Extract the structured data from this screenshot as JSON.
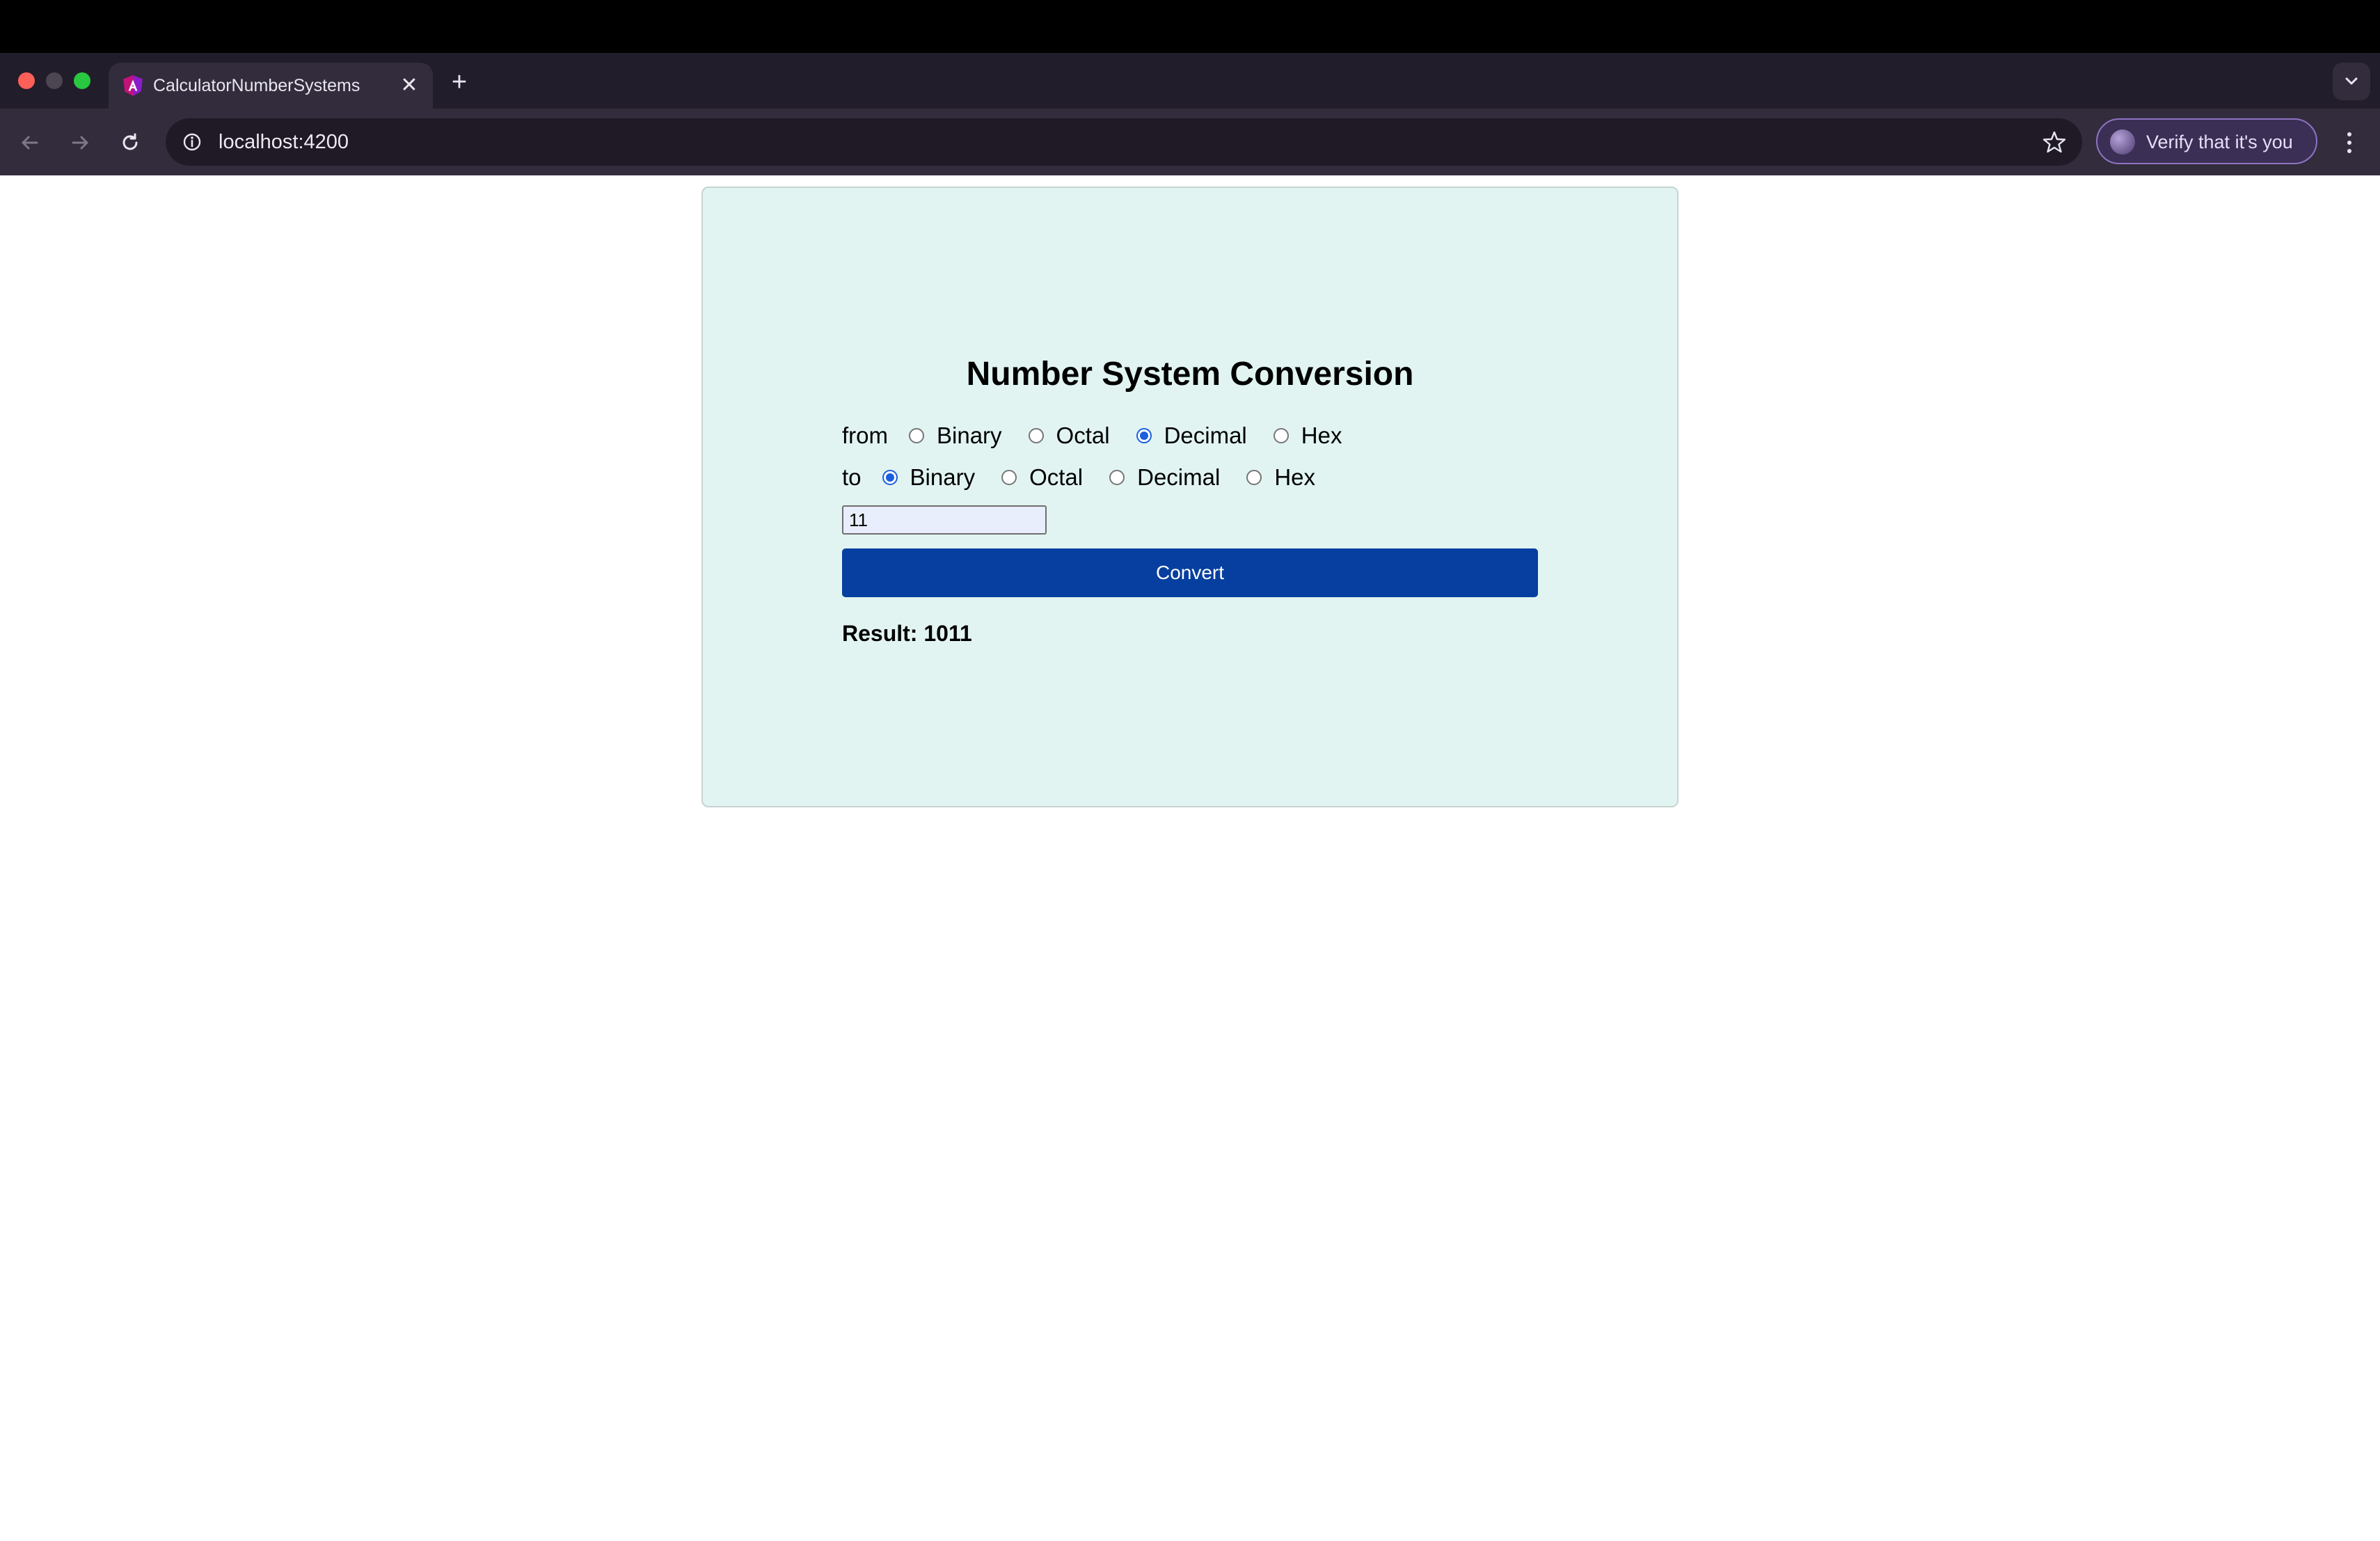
{
  "browser": {
    "tab": {
      "title": "CalculatorNumberSystems",
      "close_glyph": "✕"
    },
    "new_tab_glyph": "+",
    "address": {
      "url": "localhost:4200"
    },
    "profile": {
      "label": "Verify that it's you"
    }
  },
  "page": {
    "heading": "Number System Conversion",
    "from": {
      "label": "from",
      "options": [
        "Binary",
        "Octal",
        "Decimal",
        "Hex"
      ],
      "selected": "Decimal"
    },
    "to": {
      "label": "to",
      "options": [
        "Binary",
        "Octal",
        "Decimal",
        "Hex"
      ],
      "selected": "Binary"
    },
    "input": {
      "value": "11"
    },
    "convert_button": "Convert",
    "result": "Result: 1011"
  },
  "colors": {
    "card_background": "#e1f4f2",
    "button": "#063f9f",
    "radio_checked": "#1a5fe0",
    "profile_border": "#8f73c4"
  }
}
